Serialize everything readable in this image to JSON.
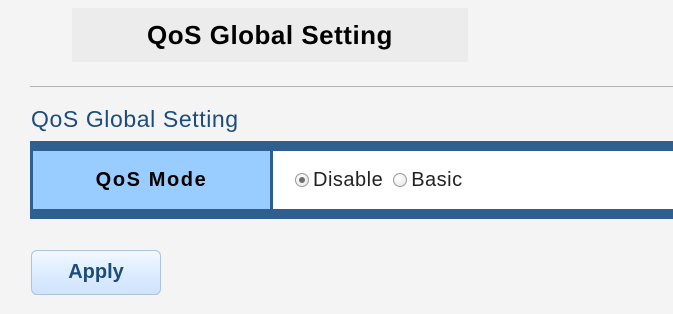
{
  "header": {
    "title": "QoS Global Setting"
  },
  "section": {
    "title": "QoS Global Setting"
  },
  "settings": {
    "qos_mode": {
      "label": "QoS Mode",
      "selected": "Disable",
      "options": [
        {
          "label": "Disable",
          "checked": true
        },
        {
          "label": "Basic",
          "checked": false
        }
      ]
    }
  },
  "actions": {
    "apply_label": "Apply"
  },
  "colors": {
    "table_border": "#2e5f8f",
    "label_background": "#99ccff",
    "section_title": "#1c4c7c",
    "page_background": "#f4f4f4"
  }
}
